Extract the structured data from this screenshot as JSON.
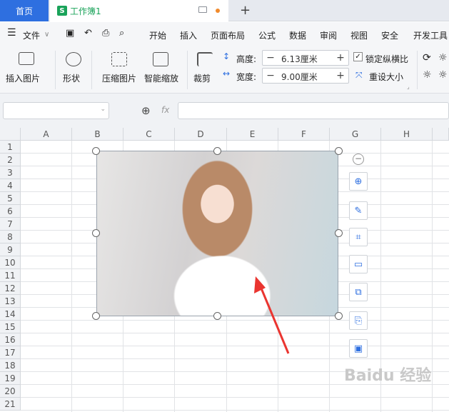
{
  "tabs": {
    "home": "首页",
    "doc_title": "工作簿1",
    "doc_icon": "S"
  },
  "menu": {
    "file": "文件",
    "items": [
      "开始",
      "插入",
      "页面布局",
      "公式",
      "数据",
      "审阅",
      "视图",
      "安全",
      "开发工具"
    ]
  },
  "ribbon": {
    "insert_picture": "插入图片",
    "shape": "形状",
    "compress": "压缩图片",
    "smart_zoom": "智能缩放",
    "crop": "裁剪",
    "height_label": "高度:",
    "height_value": "6.13厘米",
    "width_label": "宽度:",
    "width_value": "9.00厘米",
    "lock_ratio": "锁定纵横比",
    "reset_size": "重设大小"
  },
  "formula": {
    "fx": "fx",
    "namebox_value": "",
    "formula_value": ""
  },
  "columns": [
    "A",
    "B",
    "C",
    "D",
    "E",
    "F",
    "G",
    "H"
  ],
  "rows": [
    "1",
    "2",
    "3",
    "4",
    "5",
    "6",
    "7",
    "8",
    "9",
    "10",
    "11",
    "12",
    "13",
    "14",
    "15",
    "16",
    "17",
    "18",
    "19",
    "20",
    "21"
  ],
  "side_tools": [
    "zoom-in-icon",
    "edit-image-icon",
    "crop-icon",
    "fit-image-icon",
    "convert-image-icon",
    "export-image-icon",
    "replace-image-icon"
  ],
  "watermark": "Baidu 经验",
  "colors": {
    "accent": "#2e6fe0",
    "sheet_green": "#1aa35a",
    "arrow_red": "#ea3530"
  }
}
